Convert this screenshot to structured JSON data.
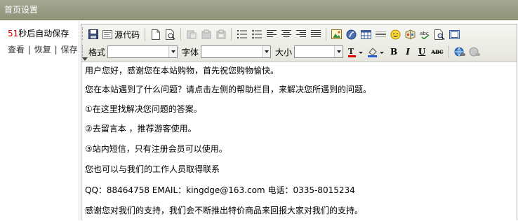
{
  "header": {
    "title": "首页设置"
  },
  "autosave": {
    "count": "51",
    "text": "秒后自动保存"
  },
  "links": {
    "view": "查看",
    "restore": "恢复",
    "save": "保存",
    "separator": "|"
  },
  "toolbar": {
    "source_label": "源代码",
    "format_label": "格式",
    "font_label": "字体",
    "size_label": "大小",
    "format_value": "",
    "font_value": "",
    "size_value": "",
    "bold": "B",
    "italic": "I",
    "underline": "U",
    "strike": "ABC"
  },
  "content": {
    "lines": [
      "用户您好，感谢您在本站购物，首先祝您购物愉快。",
      "您在本站遇到了什么问题？请点击左侧的帮助栏目，来解决您所遇到的问题。",
      "①在这里找解决您问题的答案。",
      "②去留言本 ，推荐游客使用。",
      "③站内短信，只有注册会员可以使用。",
      "您也可以与我们的工作人员取得联系",
      "QQ：88464758 EMAIL：kingdge@163.com 电话：0335-8015234",
      "感谢您对我们的支持，我们会不断推出特价商品来回报大家对我们的支持。"
    ]
  },
  "colors": {
    "titlebar": "#9a9d84",
    "countdown": "#d00000",
    "toolbar_bg": "#eeeeea"
  }
}
